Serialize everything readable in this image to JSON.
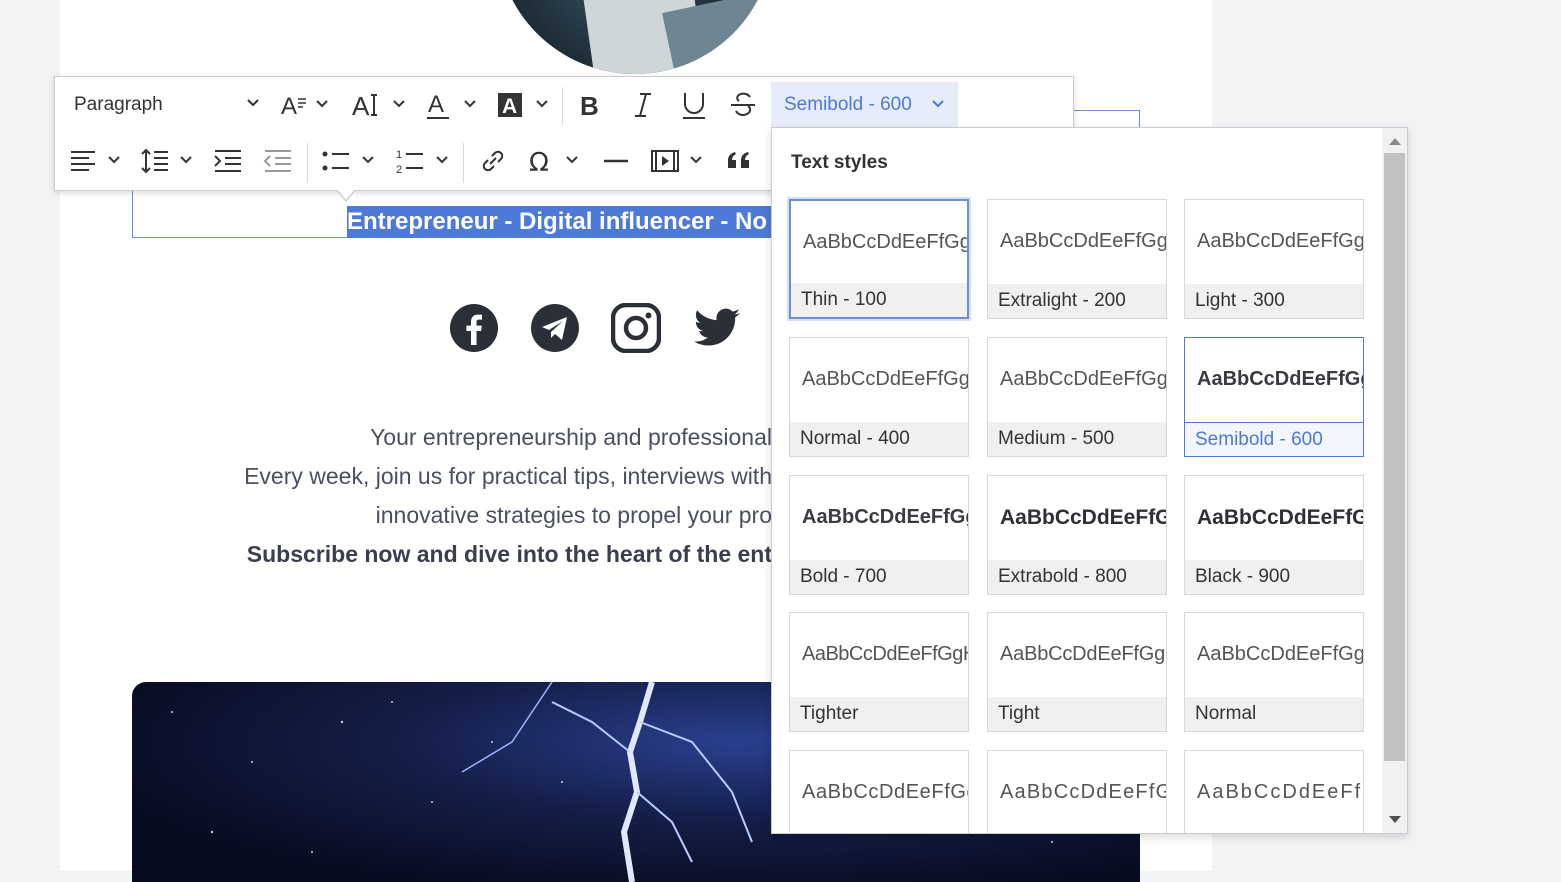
{
  "document": {
    "heading_selected_text": "Entrepreneur - Digital influencer - No",
    "description_lines": [
      "Your entrepreneurship and professional",
      "Every week, join us for practical tips, interviews with",
      "innovative strategies to propel your pro"
    ],
    "description_bold": "Subscribe now and dive into the heart of the ent",
    "social_icons": [
      "facebook-icon",
      "telegram-icon",
      "instagram-icon",
      "twitter-icon"
    ]
  },
  "toolbar": {
    "paragraph_label": "Paragraph",
    "font_weight_label": "Semibold - 600",
    "icons_row1": [
      "font-size-icon",
      "text-size-icon",
      "font-color-icon",
      "background-color-icon",
      "bold-icon",
      "italic-icon",
      "underline-icon",
      "strikethrough-icon"
    ],
    "icons_row2": [
      "align-icon",
      "line-height-icon",
      "indent-icon",
      "outdent-icon",
      "bulleted-list-icon",
      "numbered-list-icon",
      "link-icon",
      "special-characters-icon",
      "horizontal-line-icon",
      "media-icon",
      "blockquote-icon"
    ]
  },
  "panel": {
    "title": "Text styles",
    "styles": [
      {
        "preview": "AaBbCcDdEeFfGg",
        "label": "Thin - 100",
        "weight": 100
      },
      {
        "preview": "AaBbCcDdEeFfGg",
        "label": "Extralight - 200",
        "weight": 200
      },
      {
        "preview": "AaBbCcDdEeFfGg",
        "label": "Light - 300",
        "weight": 300
      },
      {
        "preview": "AaBbCcDdEeFfGg",
        "label": "Normal - 400",
        "weight": 400
      },
      {
        "preview": "AaBbCcDdEeFfGg",
        "label": "Medium - 500",
        "weight": 500
      },
      {
        "preview": "AaBbCcDdEeFfGg",
        "label": "Semibold - 600",
        "weight": 600
      },
      {
        "preview": "AaBbCcDdEeFfGg",
        "label": "Bold - 700",
        "weight": 700
      },
      {
        "preview": "AaBbCcDdEeFfGg",
        "label": "Extrabold - 800",
        "weight": 800
      },
      {
        "preview": "AaBbCcDdEeFfGg",
        "label": "Black - 900",
        "weight": 900
      },
      {
        "preview": "AaBbCcDdEeFfGgH",
        "label": "Tighter",
        "weight": 400
      },
      {
        "preview": "AaBbCcDdEeFfGgH",
        "label": "Tight",
        "weight": 400
      },
      {
        "preview": "AaBbCcDdEeFfGg",
        "label": "Normal",
        "weight": 400
      },
      {
        "preview": "AaBbCcDdEeFfGg",
        "label": "",
        "weight": 400
      },
      {
        "preview": "AaBbCcDdEeFfG",
        "label": "",
        "weight": 400
      },
      {
        "preview": "AaBbCcDdEeFf",
        "label": "",
        "weight": 400
      }
    ],
    "focused_index": 0,
    "active_index": 5
  },
  "colors": {
    "accent": "#4d79d8",
    "selection": "#4d79d8"
  }
}
